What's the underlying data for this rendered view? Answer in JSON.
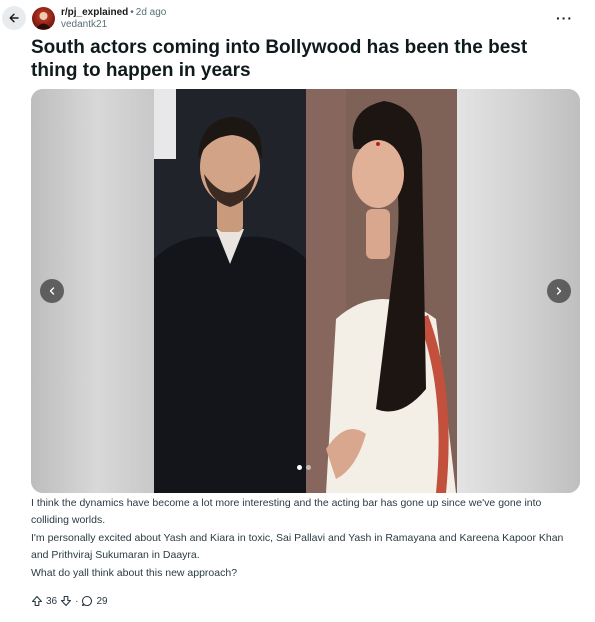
{
  "post": {
    "subreddit": "r/pj_explained",
    "separator": "•",
    "time": "2d ago",
    "author": "vedantk21",
    "more_label": "···",
    "title": "South actors coming into Bollywood has been the best thing to happen in years",
    "paragraphs": [
      "I think the dynamics have become a lot more interesting and the acting bar has gone up since we've gone into colliding worlds.",
      "I'm personally excited about Yash and Kiara in toxic, Sai Pallavi and Yash in Ramayana and Kareena Kapoor Khan and Prithviraj Sukumaran in Daayra.",
      "What do yall think about this new approach?"
    ],
    "votes": "36",
    "comments": "29"
  },
  "carousel": {
    "total_images": 2,
    "active_index": 0
  },
  "icons": {
    "back": "arrow-left-icon",
    "prev": "chevron-left-icon",
    "next": "chevron-right-icon",
    "upvote": "upvote-icon",
    "downvote": "downvote-icon",
    "comment": "comment-icon"
  }
}
